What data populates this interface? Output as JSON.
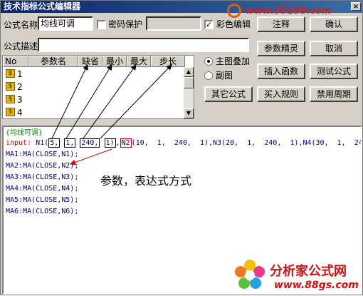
{
  "window": {
    "title": "技术指标公式编辑器",
    "close_glyph": "×"
  },
  "form": {
    "name_label": "公式名称",
    "name_value": "均线可调",
    "password_label": "密码保护",
    "password_checked": false,
    "color_label": "彩色编辑",
    "color_checked": true,
    "desc_label": "公式描述",
    "desc_value": ""
  },
  "buttons": {
    "comment": "注释",
    "confirm": "确认",
    "params_wizard": "参数精灵",
    "cancel": "取消",
    "insert_func": "插入函数",
    "test_formula": "测试公式",
    "other_formula": "其它公式",
    "buy_rule": "买入规则",
    "disable_period": "禁用周期"
  },
  "radios": {
    "main_overlay": {
      "label": "主图叠加",
      "selected": true
    },
    "sub_chart": {
      "label": "副图",
      "selected": false
    }
  },
  "param_table": {
    "headers": [
      "No",
      "参数名",
      "缺省",
      "最小",
      "最大",
      "步长"
    ],
    "rows": [
      "1",
      "2",
      "3",
      "4"
    ],
    "row_icon": "dollar-param-icon"
  },
  "code": {
    "comment_line": "{均线可调}",
    "input_keyword": "input:",
    "input_prefix": "N1(",
    "p1_default": "5,",
    "p1_min": "1,",
    "p1_max": "240,",
    "p1_step": "1)",
    "sep": ",",
    "n2_name": "N2",
    "input_rest": "(10,  1,  240,  1),N3(20,  1,  240,  1),N4(30,  1,  240,  1),",
    "ma_lines": [
      "MA1:MA(CLOSE,N1);",
      "MA2:MA(CLOSE,N2);",
      "MA3:MA(CLOSE,N3);",
      "MA4:MA(CLOSE,N4);",
      "MA5:MA(CLOSE,N5);",
      "MA6:MA(CLOSE,N6);"
    ]
  },
  "annotation": {
    "text": "参数，表达式方式"
  },
  "watermarks": {
    "top_url": "www.55188.com",
    "brand": "分析家公式网",
    "brand_url": "www.88gs.com"
  },
  "colors": {
    "accent_red": "#cc0000",
    "keyword_red": "#cc0000",
    "code_blue": "#000080",
    "comment_green": "#008000"
  }
}
